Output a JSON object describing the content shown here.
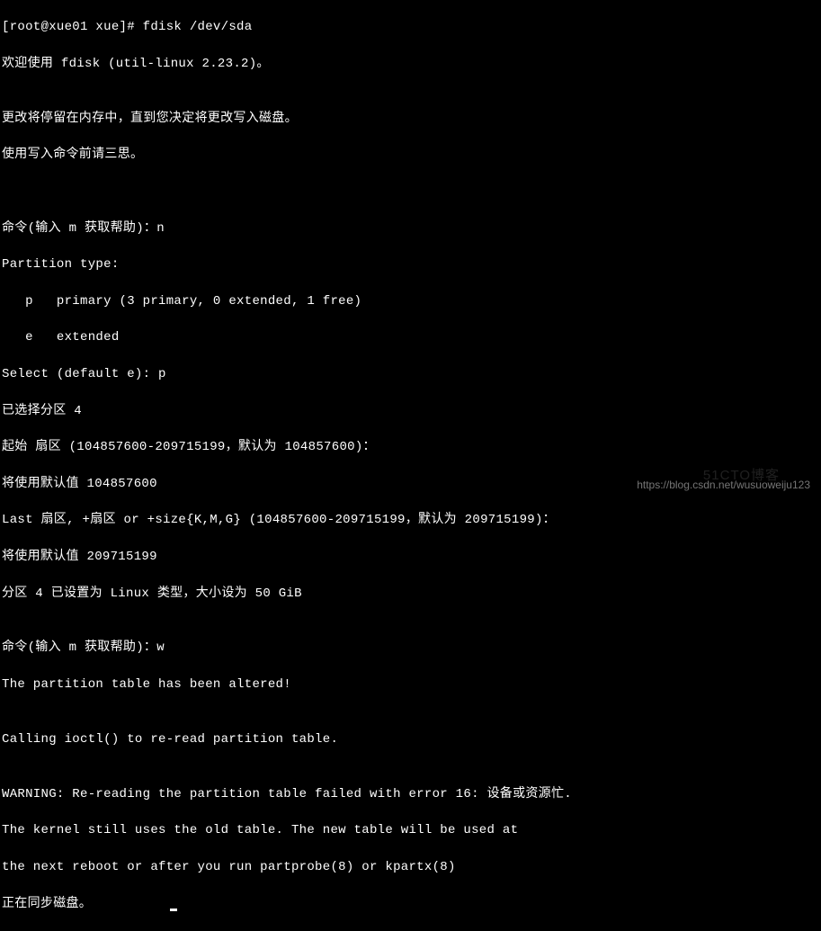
{
  "terminal": {
    "lines": [
      "[root@xue01 xue]# fdisk /dev/sda",
      "欢迎使用 fdisk (util-linux 2.23.2)。",
      "",
      "更改将停留在内存中，直到您决定将更改写入磁盘。",
      "使用写入命令前请三思。",
      "",
      "",
      "命令(输入 m 获取帮助)：n",
      "Partition type:",
      "   p   primary (3 primary, 0 extended, 1 free)",
      "   e   extended",
      "Select (default e): p",
      "已选择分区 4",
      "起始 扇区 (104857600-209715199，默认为 104857600)：",
      "将使用默认值 104857600",
      "Last 扇区, +扇区 or +size{K,M,G} (104857600-209715199，默认为 209715199)：",
      "将使用默认值 209715199",
      "分区 4 已设置为 Linux 类型，大小设为 50 GiB",
      "",
      "命令(输入 m 获取帮助)：w",
      "The partition table has been altered!",
      "",
      "Calling ioctl() to re-read partition table.",
      "",
      "WARNING: Re-reading the partition table failed with error 16: 设备或资源忙.",
      "The kernel still uses the old table. The new table will be used at",
      "the next reboot or after you run partprobe(8) or kpartx(8)",
      "正在同步磁盘。"
    ]
  },
  "watermarks": {
    "csdn": "https://blog.csdn.net/wusuoweiju123",
    "other": "51CTO博客"
  }
}
